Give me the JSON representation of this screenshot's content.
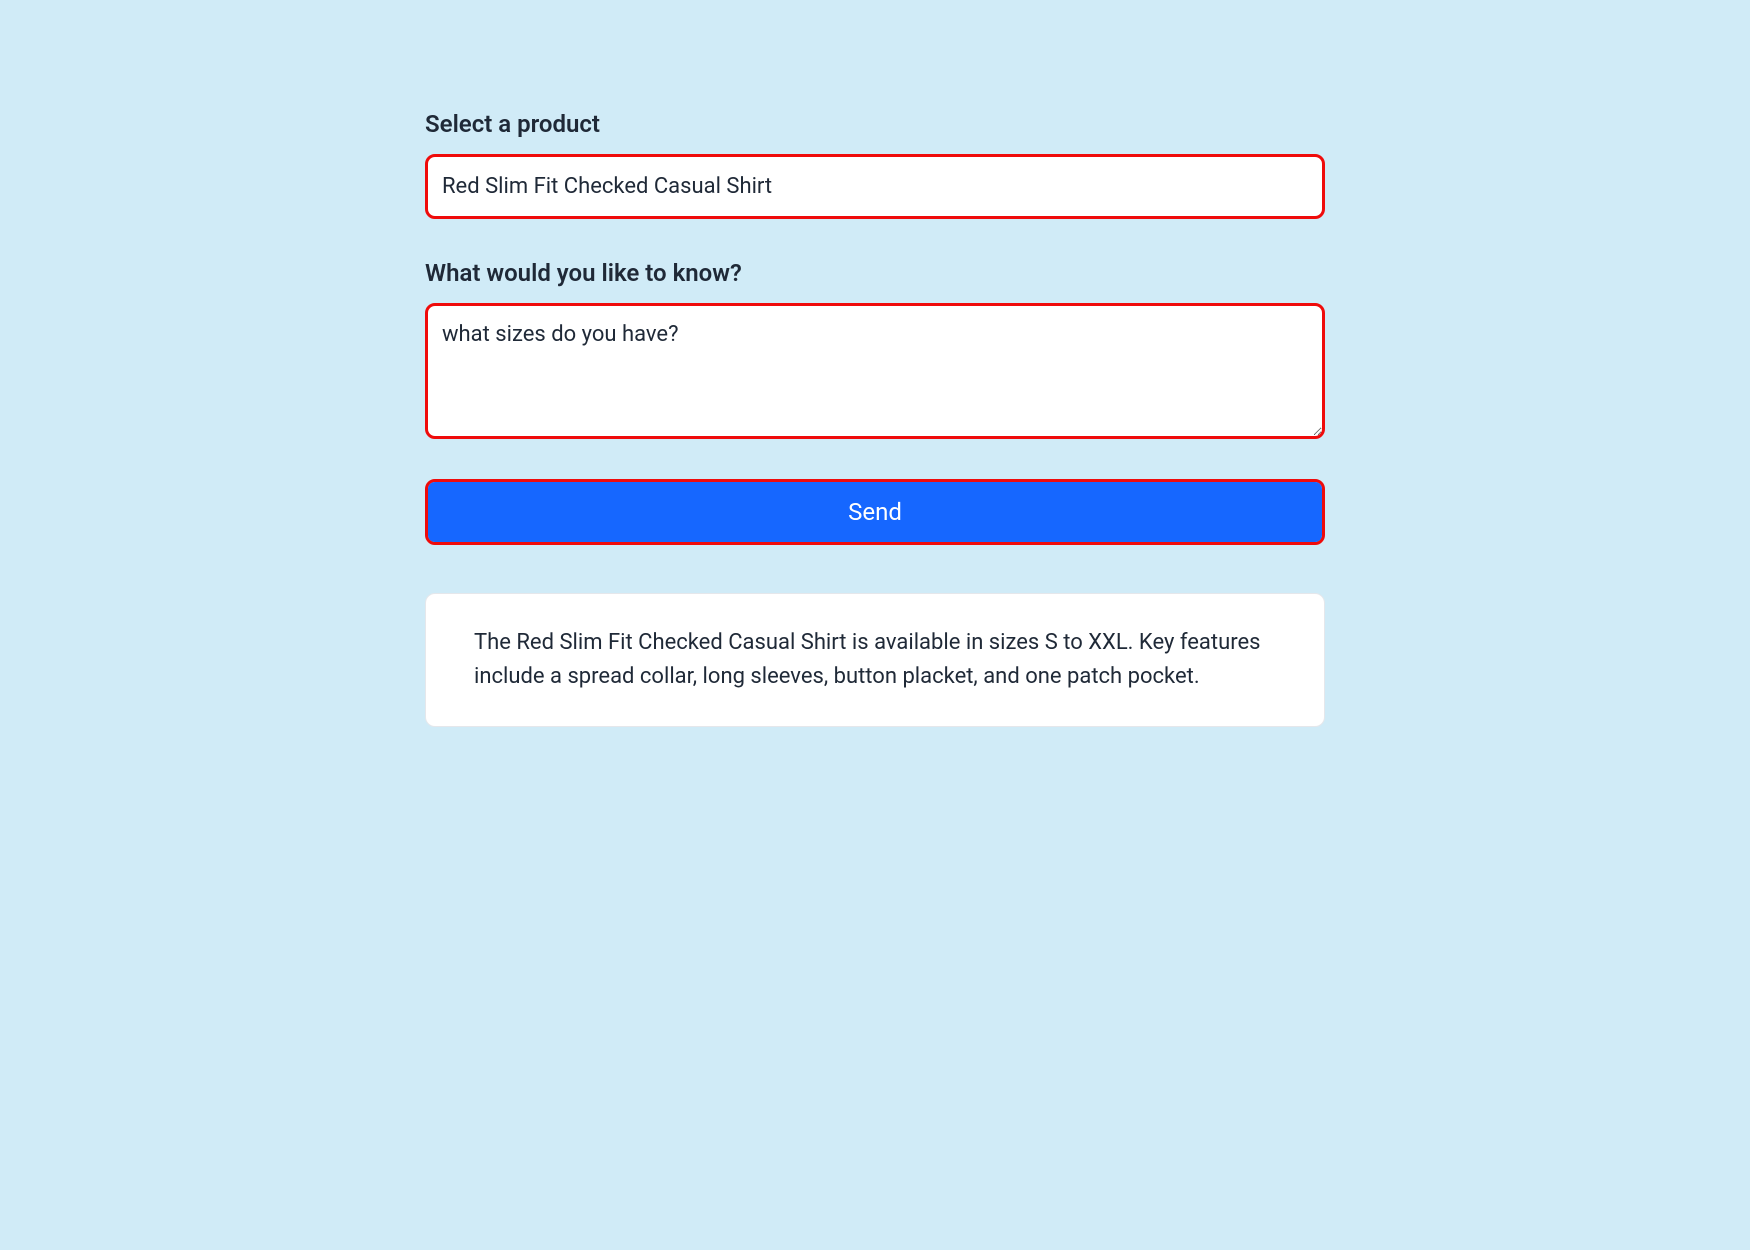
{
  "form": {
    "product_label": "Select a product",
    "product_value": "Red Slim Fit Checked Casual Shirt",
    "question_label": "What would you like to know?",
    "question_value": "what sizes do you have?",
    "send_label": "Send"
  },
  "response": {
    "text": "The Red Slim Fit Checked Casual Shirt is available in sizes S to XXL. Key features include a spread collar, long sleeves, button placket, and one patch pocket."
  },
  "colors": {
    "page_bg": "#d0ebf7",
    "highlight_border": "#ef0b0b",
    "primary_button": "#1667ff",
    "text": "#1f2937"
  }
}
